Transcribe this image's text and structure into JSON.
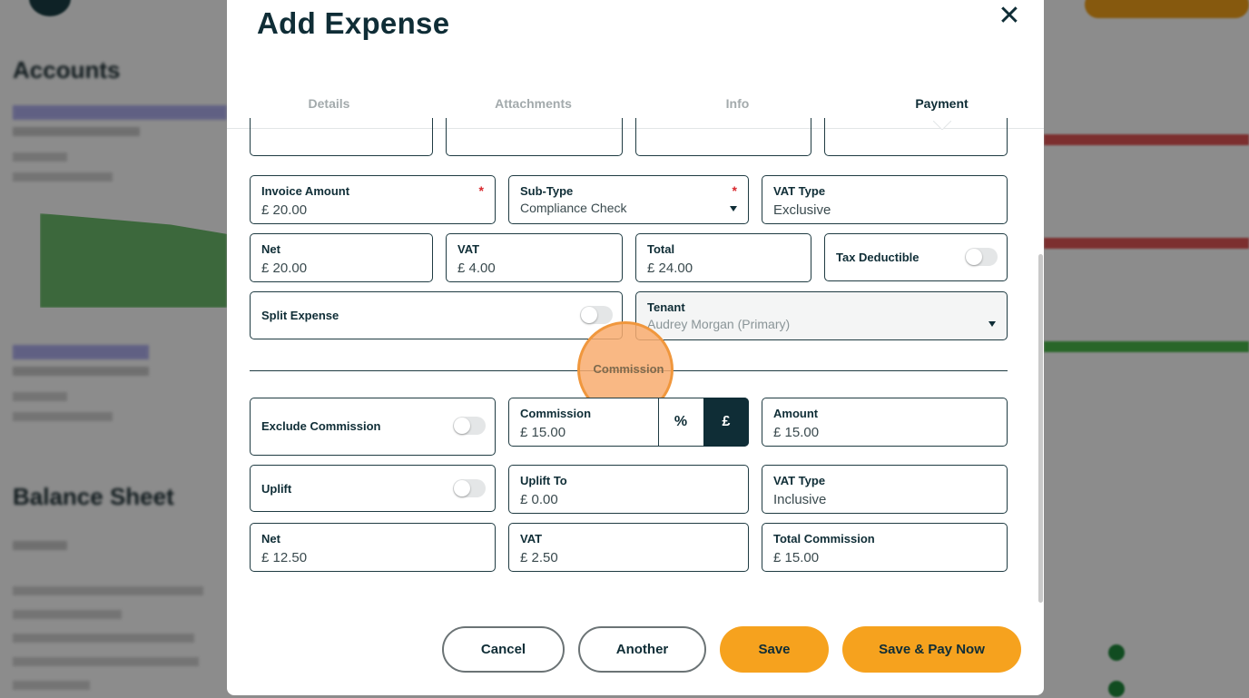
{
  "background": {
    "accounts_heading": "Accounts",
    "balance_heading": "Balance Sheet"
  },
  "modal": {
    "title": "Add Expense",
    "close_icon": "close-icon"
  },
  "tabs": [
    {
      "label": "Details"
    },
    {
      "label": "Attachments"
    },
    {
      "label": "Info"
    },
    {
      "label": "Payment",
      "active": true
    }
  ],
  "form": {
    "invoice_amount": {
      "label": "Invoice Amount",
      "value": "£ 20.00",
      "required": "*"
    },
    "sub_type": {
      "label": "Sub-Type",
      "value": "Compliance Check",
      "required": "*"
    },
    "vat_type": {
      "label": "VAT Type",
      "value": "Exclusive"
    },
    "net": {
      "label": "Net",
      "value": "£ 20.00"
    },
    "vat": {
      "label": "VAT",
      "value": "£ 4.00"
    },
    "total": {
      "label": "Total",
      "value": "£ 24.00"
    },
    "tax_deductible": {
      "label": "Tax Deductible",
      "on": false
    },
    "split_expense": {
      "label": "Split Expense",
      "on": false
    },
    "tenant": {
      "label": "Tenant",
      "value": "Audrey Morgan (Primary)"
    }
  },
  "commission": {
    "divider_label": "Commission",
    "exclude_commission": {
      "label": "Exclude Commission",
      "on": false
    },
    "commission": {
      "label": "Commission",
      "value": "£ 15.00"
    },
    "percent_label": "%",
    "pound_label": "£",
    "amount": {
      "label": "Amount",
      "value": "£ 15.00"
    },
    "uplift": {
      "label": "Uplift",
      "on": false
    },
    "uplift_to": {
      "label": "Uplift To",
      "value": "£ 0.00"
    },
    "vat_type": {
      "label": "VAT Type",
      "value": "Inclusive"
    },
    "net": {
      "label": "Net",
      "value": "£ 12.50"
    },
    "vat": {
      "label": "VAT",
      "value": "£ 2.50"
    },
    "total_commission": {
      "label": "Total Commission",
      "value": "£ 15.00"
    }
  },
  "buttons": {
    "cancel": "Cancel",
    "another": "Another",
    "save": "Save",
    "save_pay": "Save & Pay Now"
  },
  "colors": {
    "primary": "#f6a21e",
    "dark": "#0f2d36",
    "required": "#d8272d"
  }
}
